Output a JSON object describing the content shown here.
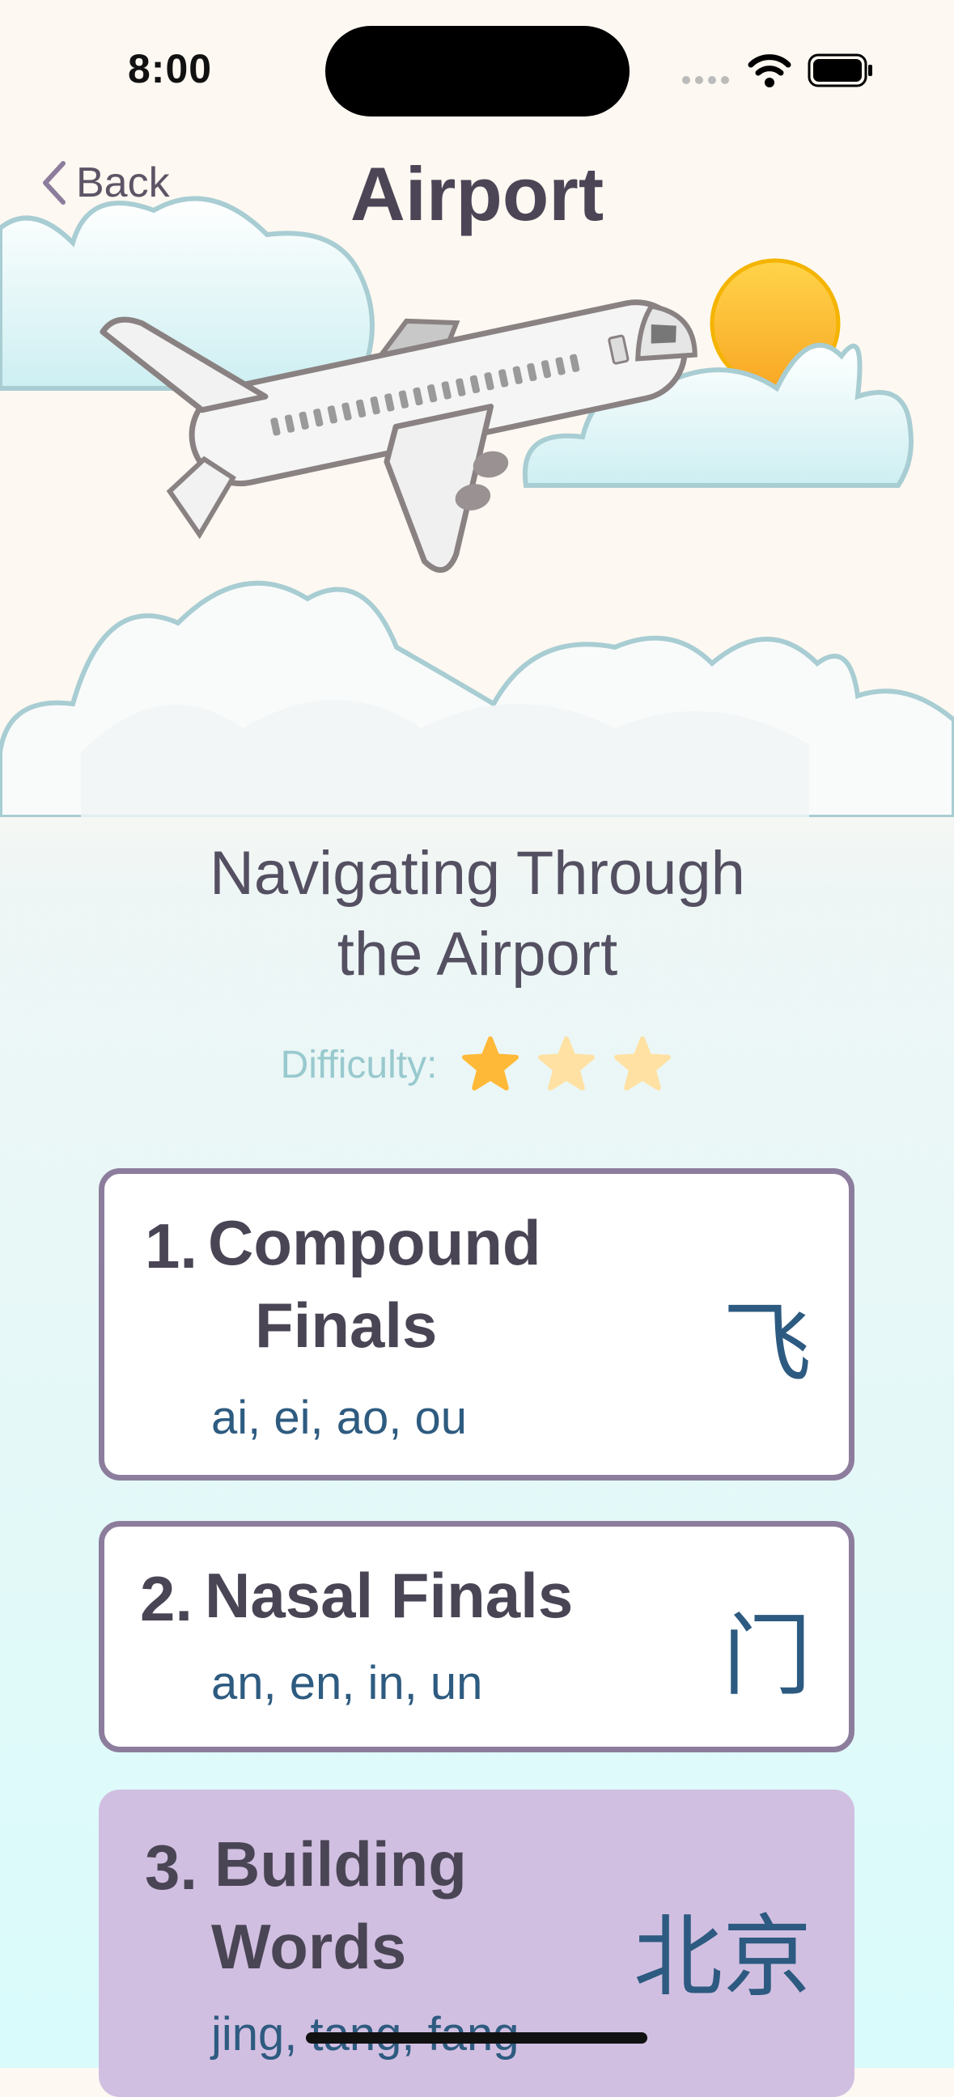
{
  "status_bar": {
    "time": "8:00"
  },
  "header": {
    "back_label": "Back",
    "title": "Airport"
  },
  "lesson": {
    "subtitle_line1": "Navigating Through",
    "subtitle_line2": "the Airport",
    "difficulty_label": "Difficulty:",
    "difficulty_rating": 1,
    "difficulty_max": 3
  },
  "cards": [
    {
      "number": "1.",
      "name_line1": "Compound",
      "name_line2": "Finals",
      "sounds": "ai, ei, ao, ou",
      "hanzi": "飞"
    },
    {
      "number": "2.",
      "name_line1": "Nasal Finals",
      "sounds": "an, en, in, un",
      "hanzi": "门"
    },
    {
      "number": "3.",
      "name_line1": "Building",
      "name_line2": "Words",
      "sounds": "jing, tang, fang",
      "hanzi": "北京"
    }
  ],
  "colors": {
    "card_border": "#8d7d9d",
    "selected_card": "#d1bfe1",
    "sound_text": "#2e5b80",
    "star_active": "#ffb938",
    "star_inactive": "#ffe1a3"
  },
  "icons": [
    "chevron-left-icon",
    "wifi-icon",
    "battery-icon",
    "signal-icon",
    "star-icon",
    "airplane-icon",
    "cloud-icon",
    "sun-icon"
  ]
}
